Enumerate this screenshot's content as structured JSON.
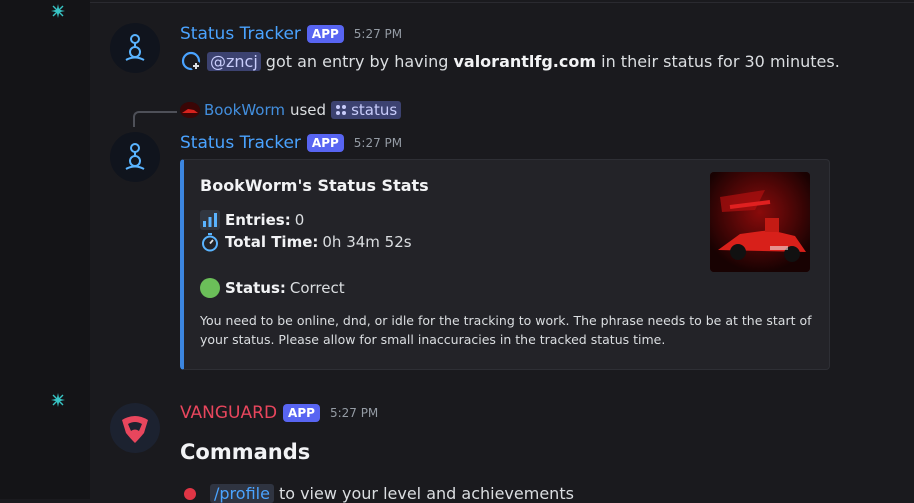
{
  "colors": {
    "accent_blue": "#4aa3ff",
    "app_badge": "#5865f2",
    "vanguard_red": "#e8465d",
    "embed_border": "#3c86e0",
    "status_green": "#6bbf59"
  },
  "messages": [
    {
      "author": "Status Tracker",
      "badge": "APP",
      "timestamp": "5:27 PM",
      "mention": "@zncj",
      "text_before": "got an entry by having",
      "bold_phrase": "valorantlfg.com",
      "text_after": "in their status for 30 minutes.",
      "leading_icon": "add-friend-icon"
    },
    {
      "reply": {
        "user": "BookWorm",
        "used": "used",
        "command": "status"
      },
      "author": "Status Tracker",
      "badge": "APP",
      "timestamp": "5:27 PM",
      "embed": {
        "title": "BookWorm's Status Stats",
        "entries_label": "Entries:",
        "entries_value": "0",
        "total_time_label": "Total Time:",
        "total_time_value": "0h 34m 52s",
        "status_label": "Status:",
        "status_value": "Correct",
        "note": "You need to be online, dnd, or idle for the tracking to work. The phrase needs to be at the start of your status. Please allow for small inaccuracies in the tracked status time."
      }
    },
    {
      "author": "VANGUARD",
      "badge": "APP",
      "timestamp": "5:27 PM",
      "heading": "Commands",
      "command": "/profile",
      "command_desc": "to view your level and achievements"
    }
  ]
}
